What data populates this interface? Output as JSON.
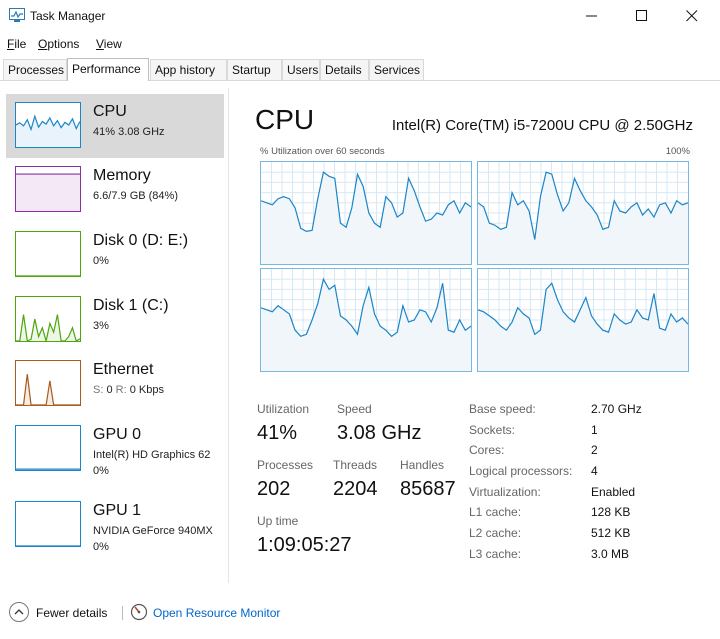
{
  "window": {
    "title": "Task Manager"
  },
  "menu": [
    {
      "label": "File",
      "key": "F",
      "rest": "ile"
    },
    {
      "label": "Options",
      "key": "O",
      "rest": "ptions"
    },
    {
      "label": "View",
      "key": "V",
      "rest": "iew"
    }
  ],
  "tabs": [
    {
      "label": "Processes",
      "active": false
    },
    {
      "label": "Performance",
      "active": true
    },
    {
      "label": "App history",
      "active": false
    },
    {
      "label": "Startup",
      "active": false
    },
    {
      "label": "Users",
      "active": false
    },
    {
      "label": "Details",
      "active": false
    },
    {
      "label": "Services",
      "active": false
    }
  ],
  "sidebar": {
    "items": [
      {
        "name": "CPU",
        "sub": "41%  3.08 GHz",
        "selected": true,
        "color": "#1b85c8"
      },
      {
        "name": "Memory",
        "sub": "6.6/7.9 GB (84%)",
        "color": "#8b2fa0"
      },
      {
        "name": "Disk 0 (D: E:)",
        "sub": "0%",
        "color": "#4da60c"
      },
      {
        "name": "Disk 1 (C:)",
        "sub": "3%",
        "color": "#4da60c"
      },
      {
        "name": "Ethernet",
        "sub_s": "S:",
        "sub_s_val": "0",
        "sub_r": "R:",
        "sub_r_val": "0 Kbps",
        "color": "#a75b1c"
      },
      {
        "name": "GPU 0",
        "sub": "Intel(R) HD Graphics 62",
        "sub2": "0%",
        "color": "#1b85c8"
      },
      {
        "name": "GPU 1",
        "sub": "NVIDIA GeForce 940MX",
        "sub2": "0%",
        "color": "#1b85c8"
      }
    ]
  },
  "main": {
    "title": "CPU",
    "model": "Intel(R) Core(TM) i5-7200U CPU @ 2.50GHz",
    "graph_label": "% Utilization over 60 seconds",
    "graph_max": "100%",
    "stats": {
      "utilization_label": "Utilization",
      "utilization": "41%",
      "speed_label": "Speed",
      "speed": "3.08 GHz",
      "processes_label": "Processes",
      "processes": "202",
      "threads_label": "Threads",
      "threads": "2204",
      "handles_label": "Handles",
      "handles": "85687",
      "uptime_label": "Up time",
      "uptime": "1:09:05:27"
    },
    "specs": [
      {
        "label": "Base speed:",
        "value": "2.70 GHz"
      },
      {
        "label": "Sockets:",
        "value": "1"
      },
      {
        "label": "Cores:",
        "value": "2"
      },
      {
        "label": "Logical processors:",
        "value": "4"
      },
      {
        "label": "Virtualization:",
        "value": "Enabled"
      },
      {
        "label": "L1 cache:",
        "value": "128 KB"
      },
      {
        "label": "L2 cache:",
        "value": "512 KB"
      },
      {
        "label": "L3 cache:",
        "value": "3.0 MB"
      }
    ]
  },
  "footer": {
    "fewer_details": "Fewer details",
    "open_resource_monitor": "Open Resource Monitor"
  },
  "graph_series": {
    "core0": [
      62,
      60,
      58,
      64,
      66,
      64,
      55,
      35,
      32,
      33,
      64,
      90,
      86,
      84,
      40,
      36,
      55,
      88,
      76,
      50,
      40,
      36,
      66,
      60,
      46,
      50,
      84,
      72,
      56,
      42,
      44,
      50,
      48,
      58,
      62,
      50,
      60,
      56
    ],
    "core1": [
      60,
      56,
      40,
      38,
      34,
      36,
      70,
      58,
      62,
      52,
      24,
      66,
      90,
      88,
      68,
      52,
      60,
      84,
      72,
      62,
      56,
      48,
      34,
      36,
      62,
      52,
      50,
      56,
      60,
      48,
      54,
      46,
      58,
      60,
      50,
      62,
      58,
      60
    ],
    "core2": [
      62,
      60,
      58,
      64,
      60,
      56,
      40,
      34,
      36,
      50,
      66,
      90,
      80,
      84,
      54,
      50,
      44,
      36,
      64,
      82,
      56,
      44,
      40,
      34,
      38,
      64,
      48,
      50,
      60,
      58,
      48,
      62,
      86,
      40,
      38,
      50,
      40,
      44
    ],
    "core3": [
      60,
      58,
      54,
      50,
      44,
      40,
      48,
      62,
      56,
      52,
      36,
      40,
      80,
      86,
      70,
      58,
      52,
      48,
      60,
      72,
      54,
      46,
      40,
      38,
      56,
      50,
      46,
      48,
      60,
      52,
      50,
      76,
      42,
      40,
      56,
      48,
      52,
      46
    ]
  },
  "thumb_series": {
    "cpu": [
      50,
      55,
      48,
      62,
      40,
      70,
      45,
      58,
      52,
      66,
      48,
      60,
      44,
      56,
      50,
      64,
      42,
      58
    ],
    "memory": [
      84
    ],
    "disk0": [
      0
    ],
    "disk1": [
      0,
      0,
      60,
      0,
      4,
      50,
      10,
      30,
      0,
      40,
      20,
      60,
      0,
      0,
      10,
      30,
      0,
      5
    ],
    "ethernet": [
      0,
      0,
      0,
      70,
      0,
      0,
      0,
      0,
      0,
      55,
      0,
      0,
      0,
      0,
      0,
      0,
      0,
      0
    ],
    "gpu0": [
      2,
      2,
      2,
      2,
      2,
      2,
      2,
      2,
      2,
      2,
      2,
      2,
      2,
      2,
      2,
      2,
      2,
      2
    ],
    "gpu1": [
      0
    ]
  },
  "colors": {
    "cpu_line": "#1b85c8",
    "cpu_fill": "#f1f6fa",
    "grid": "#d7e8f4",
    "link": "#0066cc"
  }
}
